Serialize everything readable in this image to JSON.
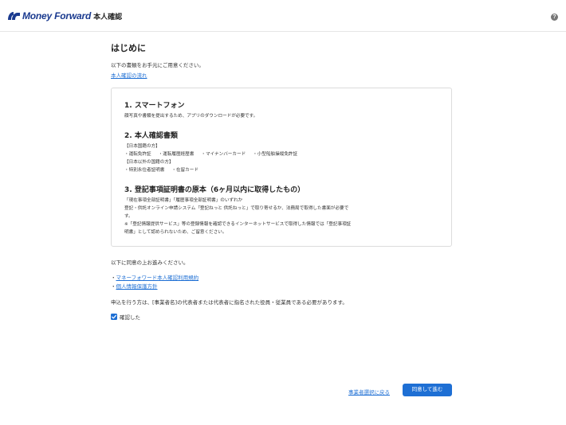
{
  "header": {
    "brand": "Money Forward",
    "subtitle": "本人確認",
    "help_icon": "?"
  },
  "main": {
    "title": "はじめに",
    "intro": "以下の書類をお手元にご用意ください。",
    "flow_link": "本人確認の流れ"
  },
  "card": {
    "sections": [
      {
        "title": "1. スマートフォン",
        "lines": [
          "顔写真や書類を提出するため、アプリのダウンロードが必要です。"
        ]
      },
      {
        "title": "2. 本人確認書類",
        "group1_label": "【日本国籍の方】",
        "group1_items": [
          "・運転免許証",
          "・運転履歴経歴書",
          "・マイナンバーカード",
          "・小型船舶操縦免許証"
        ],
        "group2_label": "【日本以外の国籍の方】",
        "group2_items": [
          "・特別永住者証明書",
          "・在留カード"
        ]
      },
      {
        "title": "3. 登記事項証明書の原本（6ヶ月以内に取得したもの）",
        "line1": "「現在事項全部証明書」「履歴事項全部証明書」のいずれか",
        "line2": "登記・供託オンライン申請システム「登記ねっと 供託ねっと」で取り寄せるか、法務局で取得した書面が必要で",
        "line3": "す。",
        "line4": "※「登記情報提供サービス」等の登録情報を確認できるインターネットサービスで取得した情報では「登記事項証",
        "line5": "明書」として認められないため、ご留意ください。"
      }
    ]
  },
  "agreement": {
    "text": "以下に同意の上お進みください。",
    "links": [
      "マネーフォワード本人確認利用規約",
      "個人情報保護方針"
    ],
    "bullet": "・",
    "notice": "申込を行う方は、[事業者名]の代表者または代表者に指名された役員・従業員である必要があります。",
    "checkbox_label": "確認した",
    "checkbox_checked": true
  },
  "footer": {
    "back_link": "事業者選択に戻る",
    "next_button": "同意して進む"
  },
  "colors": {
    "accent": "#1e6fd4",
    "brand": "#1a3a8f"
  }
}
